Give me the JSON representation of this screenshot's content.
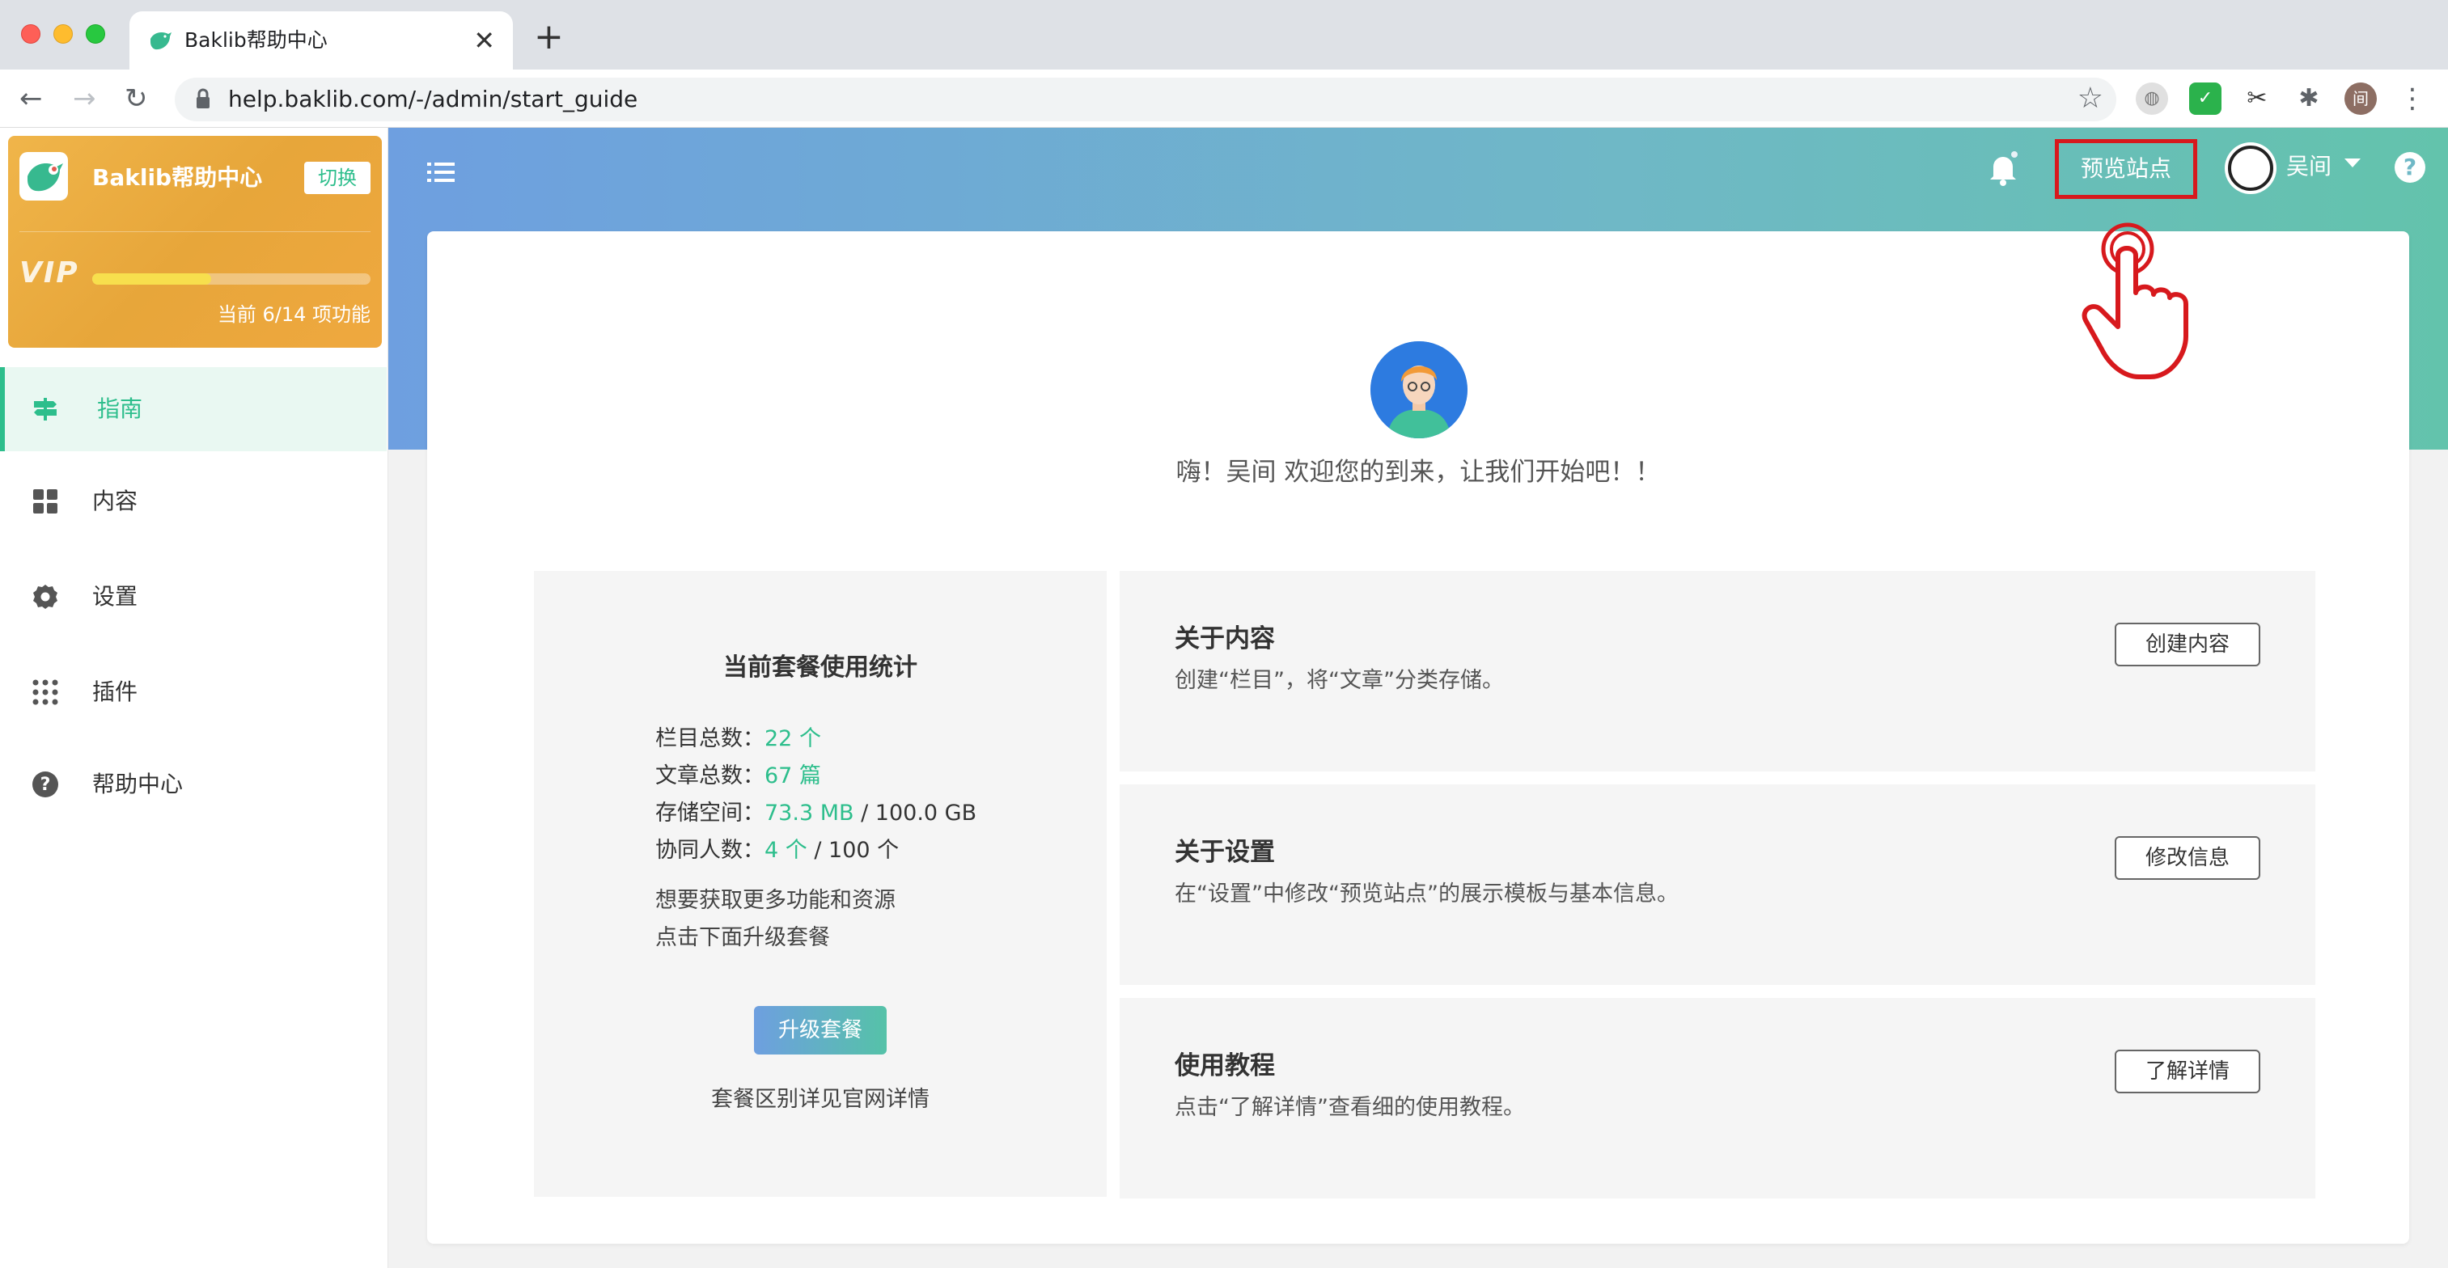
{
  "browser": {
    "tab_title": "Baklib帮助中心",
    "tab_close": "✕",
    "new_tab": "+",
    "url": "help.baklib.com/-/admin/start_guide",
    "profile_initial": "间"
  },
  "brand": {
    "name": "Baklib帮助中心",
    "switch_label": "切换",
    "vip_label": "VIP",
    "features_used": 6,
    "features_total": 14,
    "progress_text": "当前 6/14 项功能",
    "accent_color": "#2dbe8c"
  },
  "sidebar": {
    "items": [
      {
        "label": "指南",
        "icon": "signpost-icon",
        "active": true
      },
      {
        "label": "内容",
        "icon": "grid-icon",
        "active": false
      },
      {
        "label": "设置",
        "icon": "gear-icon",
        "active": false
      },
      {
        "label": "插件",
        "icon": "dots-grid-icon",
        "active": false
      },
      {
        "label": "帮助中心",
        "icon": "help-circle-icon",
        "active": false
      }
    ]
  },
  "header": {
    "preview_site_label": "预览站点",
    "user_name": "吴间",
    "help_glyph": "?"
  },
  "main": {
    "welcome_text": "嗨！吴间 欢迎您的到来，让我们开始吧！！",
    "stats": {
      "title": "当前套餐使用统计",
      "rows": [
        {
          "label": "栏目总数：",
          "value": "22 个",
          "total": ""
        },
        {
          "label": "文章总数：",
          "value": "67 篇",
          "total": ""
        },
        {
          "label": "存储空间：",
          "value": "73.3 MB",
          "total": " / 100.0 GB"
        },
        {
          "label": "协同人数：",
          "value": "4 个",
          "total": " / 100 个"
        }
      ],
      "note_line1": "想要获取更多功能和资源",
      "note_line2": "点击下面升级套餐",
      "upgrade_label": "升级套餐",
      "footer": "套餐区别详见官网详情"
    },
    "cards": [
      {
        "title": "关于内容",
        "desc": "创建“栏目”，将“文章”分类存储。",
        "button": "创建内容"
      },
      {
        "title": "关于设置",
        "desc": "在“设置”中修改“预览站点”的展示模板与基本信息。",
        "button": "修改信息"
      },
      {
        "title": "使用教程",
        "desc": "点击“了解详情”查看细的使用教程。",
        "button": "了解详情"
      }
    ]
  }
}
